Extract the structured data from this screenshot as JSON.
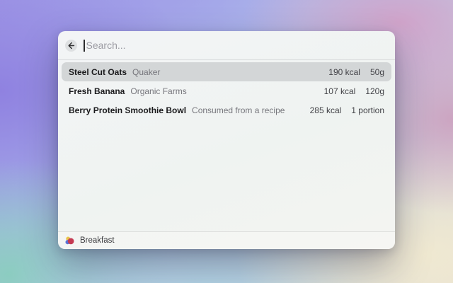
{
  "window": {
    "search": {
      "placeholder": "Search...",
      "value": ""
    },
    "results": {
      "selected_index": 0,
      "rows": [
        {
          "name": "Steel Cut Oats",
          "detail": "Quaker",
          "kcal": "190 kcal",
          "amount": "50g"
        },
        {
          "name": "Fresh Banana",
          "detail": "Organic Farms",
          "kcal": "107 kcal",
          "amount": "120g"
        },
        {
          "name": "Berry Protein Smoothie Bowl",
          "detail": "Consumed from a recipe",
          "kcal": "285 kcal",
          "amount": "1 portion"
        }
      ]
    },
    "footer": {
      "label": "Breakfast"
    }
  },
  "icons": {
    "back": "left-arrow",
    "footer": "meal-app-icon"
  },
  "colors": {
    "selection": "#d3d6d7",
    "primary_text": "#1a1a1c",
    "secondary_text": "#76767c",
    "value_text": "#424247",
    "placeholder_text": "#9c9ca3",
    "icon_red": "#c53a52",
    "icon_blue": "#5873d6",
    "icon_yellow": "#e9c44b"
  }
}
